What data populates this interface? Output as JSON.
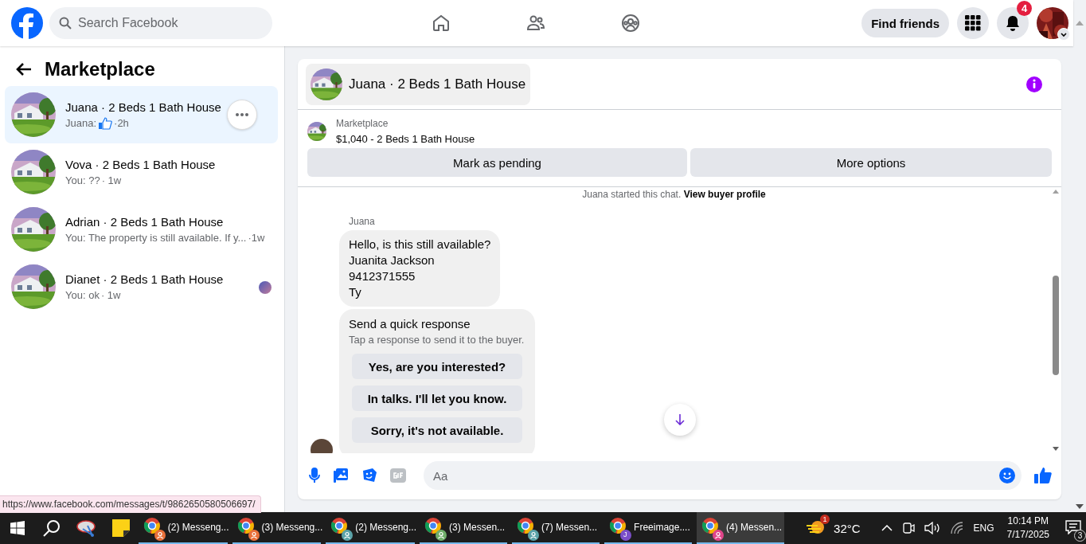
{
  "topbar": {
    "search": {
      "placeholder": "Search Facebook"
    },
    "nav": [
      {
        "kind": "home"
      },
      {
        "kind": "friends"
      },
      {
        "kind": "groups"
      }
    ],
    "find_friends": "Find friends",
    "notification_count": "4"
  },
  "sidebar": {
    "title": "Marketplace",
    "conversations": [
      {
        "name": "Juana · 2 Beds 1 Bath House",
        "preview": "Juana:",
        "liked": true,
        "time": "·2h",
        "selected": true,
        "seen": false
      },
      {
        "name": "Vova · 2 Beds 1 Bath House",
        "preview": "You: ??",
        "liked": false,
        "time": "· 1w",
        "selected": false,
        "seen": false
      },
      {
        "name": "Adrian · 2 Beds 1 Bath House",
        "preview": "You: The property is still available. If y...",
        "liked": false,
        "time": "·1w",
        "selected": false,
        "seen": false
      },
      {
        "name": "Dianet · 2 Beds 1 Bath House",
        "preview": "You: ok",
        "liked": false,
        "time": "· 1w",
        "selected": false,
        "seen": true
      }
    ]
  },
  "chat": {
    "title": "Juana · 2 Beds 1 Bath House",
    "listing_source": "Marketplace",
    "listing": "$1,040 - 2 Beds 1 Bath House",
    "actions": [
      "Mark as pending",
      "More options"
    ],
    "notice": "Juana started this chat. **View buyer profile**",
    "sender": "Juana",
    "message": "Hello, is this still available?\nJuanita Jackson\n9412371555\nTy",
    "quick_response": {
      "title": "Send a quick response",
      "hint": "Tap a response to send it to the buyer.",
      "options": [
        "Yes, are you interested?",
        "In talks. I'll let you know.",
        "Sorry, it's not available."
      ]
    },
    "composer": {
      "placeholder": "Aa"
    }
  },
  "status_url": "https://www.facebook.com/messages/t/9862650580506697/",
  "taskbar": {
    "apps": [
      {
        "label": "(2) Messeng...",
        "color": "#e8703a",
        "selected": false
      },
      {
        "label": "(3) Messeng...",
        "color": "#e8703a",
        "selected": false
      },
      {
        "label": "(2) Messeng...",
        "color": "#5ba3a8",
        "selected": false
      },
      {
        "label": "(3) Messen...",
        "color": "#6fae6a",
        "selected": false
      },
      {
        "label": "(7) Messen...",
        "color": "#5ba3a8",
        "selected": false
      },
      {
        "label": "Freeimage....",
        "color": "#7b4fc9",
        "badge": "J",
        "selected": false
      },
      {
        "label": "(4) Messen...",
        "color": "#e0458a",
        "selected": true
      }
    ],
    "weather_badge": "1",
    "temperature": "32°C",
    "language": "ENG",
    "time": "10:14 PM",
    "date": "7/17/2025",
    "notification_count": "3"
  }
}
